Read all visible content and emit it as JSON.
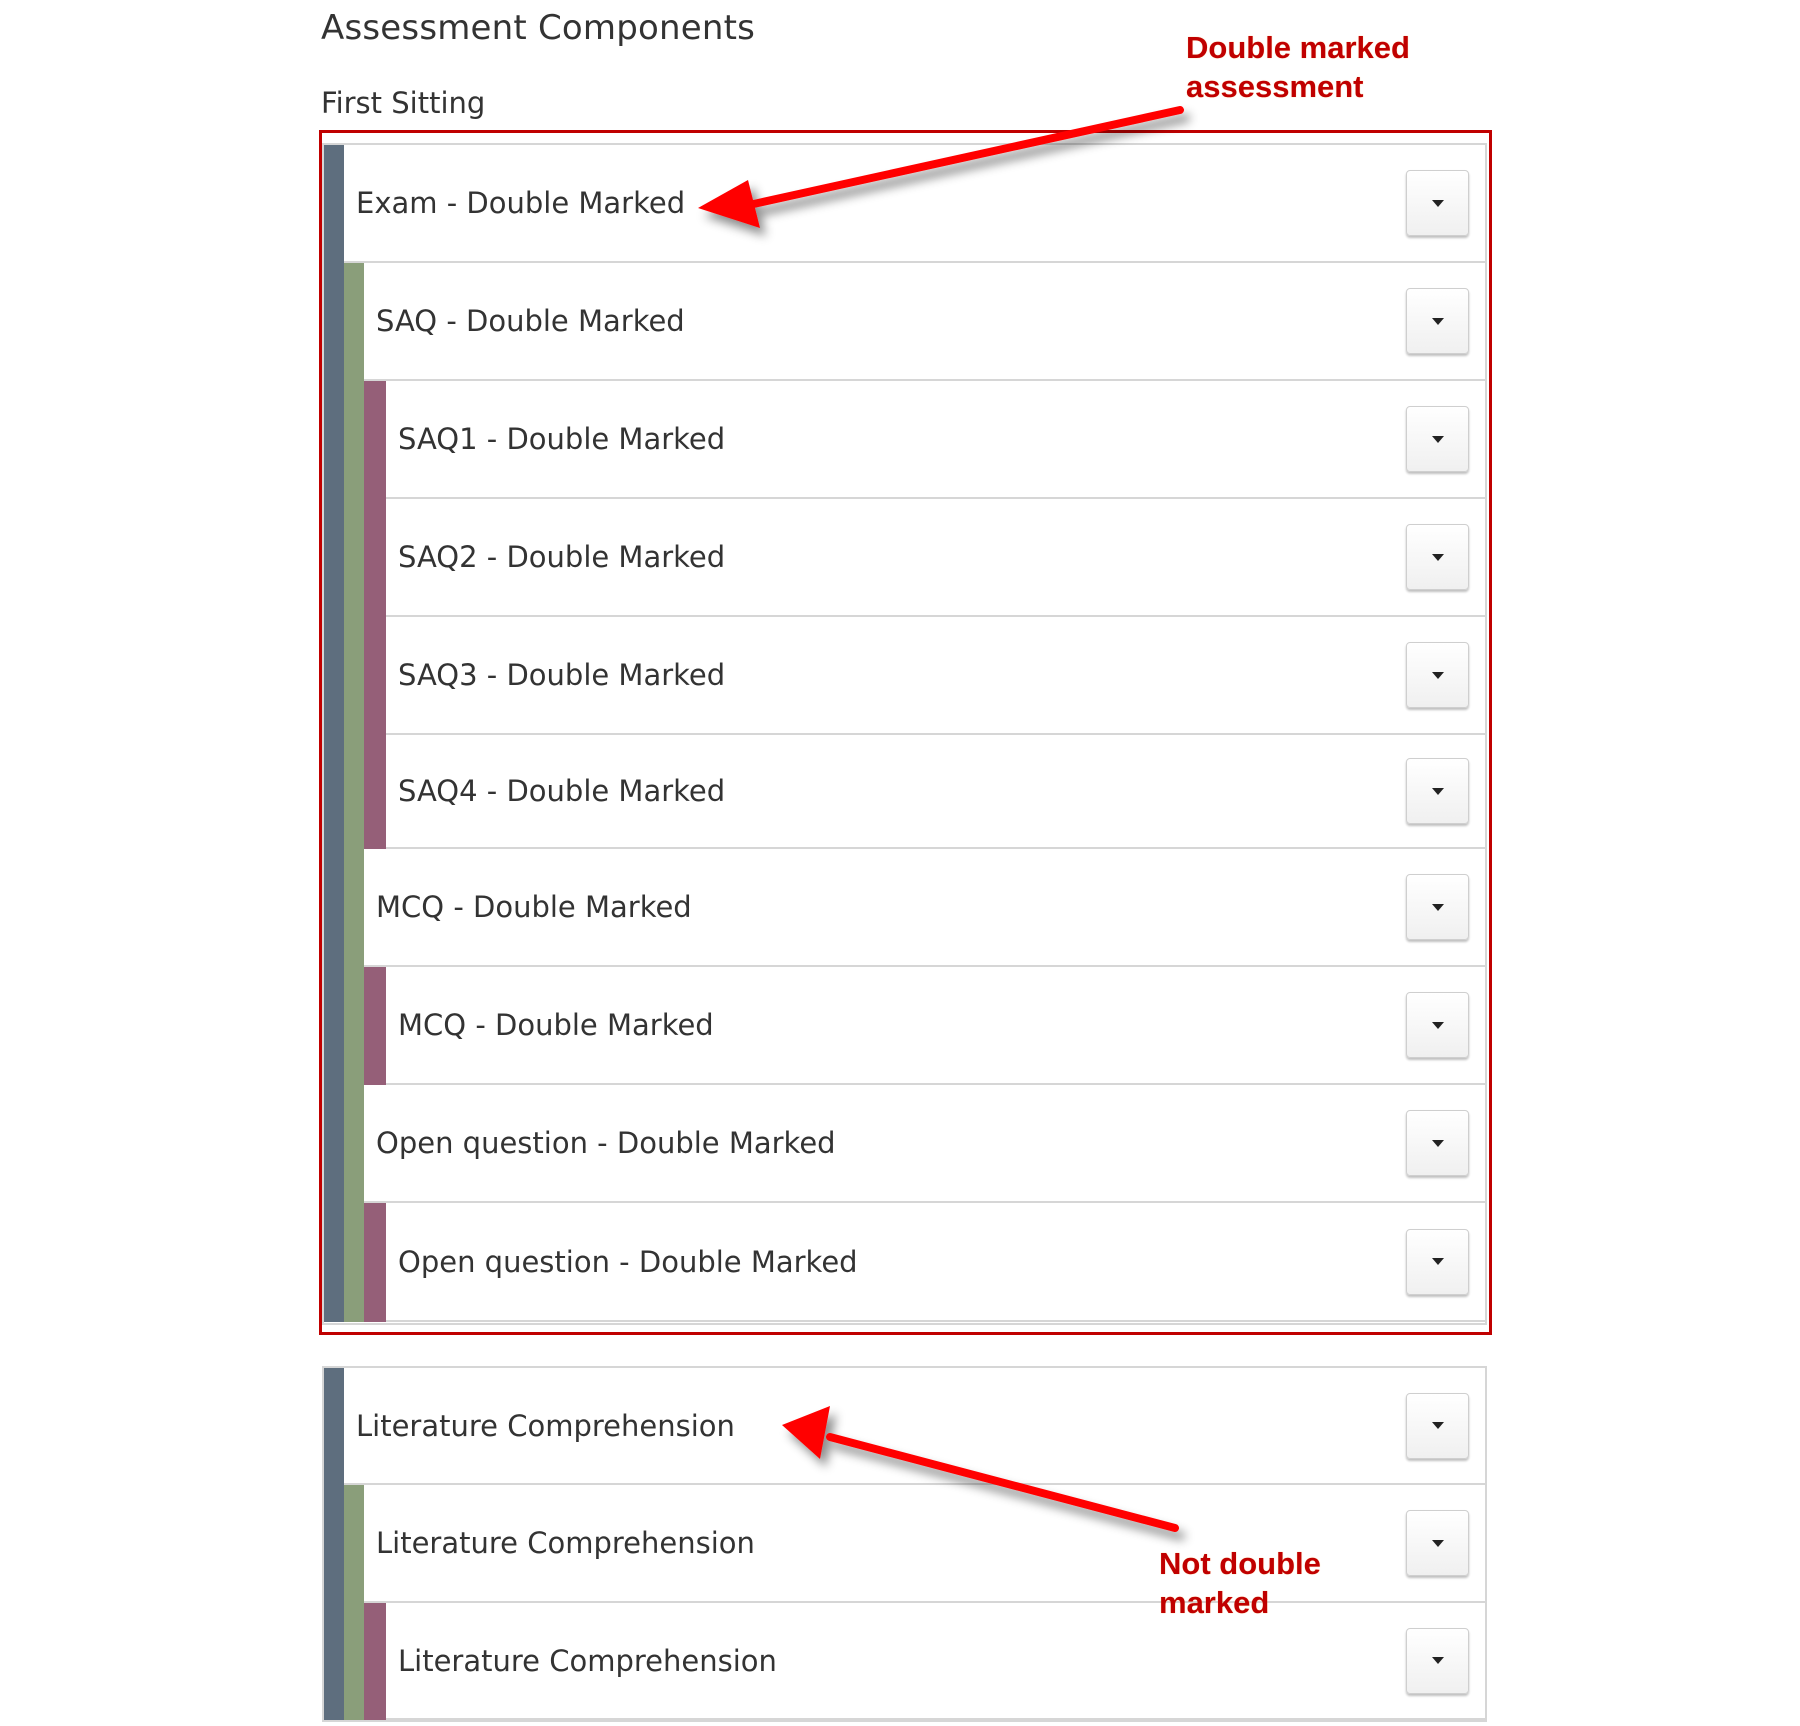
{
  "page": {
    "title": "Assessment Components",
    "section_label": "First Sitting"
  },
  "colors": {
    "level0_bar": "#5e6e7e",
    "level1_bar": "#8a9e7a",
    "level2_bar": "#955f78",
    "annotation_red": "#c00000",
    "arrow_red": "#ff0000"
  },
  "double_marked_group": {
    "rows": [
      {
        "label": "Exam - Double Marked",
        "level": 0,
        "button_icon": "caret-down-icon"
      },
      {
        "label": "SAQ - Double Marked",
        "level": 1,
        "button_icon": "caret-down-icon"
      },
      {
        "label": "SAQ1 - Double Marked",
        "level": 2,
        "button_icon": "caret-down-icon"
      },
      {
        "label": "SAQ2 - Double Marked",
        "level": 2,
        "button_icon": "caret-down-icon"
      },
      {
        "label": "SAQ3 - Double Marked",
        "level": 2,
        "button_icon": "caret-down-icon"
      },
      {
        "label": "SAQ4 - Double Marked",
        "level": 2,
        "button_icon": "caret-down-icon"
      },
      {
        "label": "MCQ - Double Marked",
        "level": 1,
        "button_icon": "caret-down-icon"
      },
      {
        "label": "MCQ - Double Marked",
        "level": 2,
        "button_icon": "caret-down-icon"
      },
      {
        "label": "Open question - Double Marked",
        "level": 1,
        "button_icon": "caret-down-icon"
      },
      {
        "label": "Open question - Double Marked",
        "level": 2,
        "button_icon": "caret-down-icon"
      }
    ]
  },
  "single_marked_group": {
    "rows": [
      {
        "label": "Literature Comprehension",
        "level": 0,
        "button_icon": "caret-down-icon"
      },
      {
        "label": "Literature Comprehension",
        "level": 1,
        "button_icon": "caret-down-icon"
      },
      {
        "label": "Literature Comprehension",
        "level": 2,
        "button_icon": "caret-down-icon"
      }
    ]
  },
  "annotations": {
    "double_marked": {
      "line1": "Double marked",
      "line2": "assessment"
    },
    "not_double_marked": {
      "line1": "Not double",
      "line2": "marked"
    }
  }
}
